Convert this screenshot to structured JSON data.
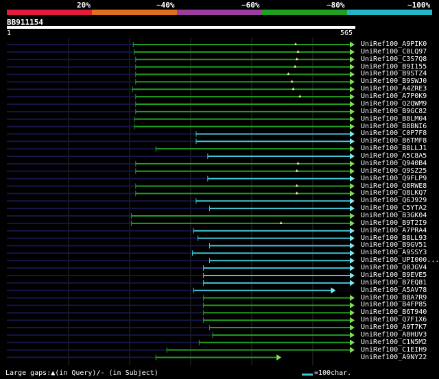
{
  "legend": {
    "labels": [
      "20%",
      "~40%",
      "~60%",
      "~80%",
      "~100%"
    ],
    "colors": [
      "#e01e3c",
      "#e07020",
      "#9a3fa0",
      "#20a020",
      "#20b8c8"
    ]
  },
  "query": {
    "id": "BB911154",
    "start": "1",
    "end": "565",
    "length": 565
  },
  "hits": [
    {
      "name": "UniRef100_A9PIK0",
      "start": 208,
      "end": 565,
      "color": "green",
      "marks": [
        474
      ]
    },
    {
      "name": "UniRef100_C0LQ97",
      "start": 210,
      "end": 565,
      "color": "green",
      "marks": [
        478
      ]
    },
    {
      "name": "UniRef100_C3S7Q8",
      "start": 212,
      "end": 565,
      "color": "green",
      "marks": [
        476
      ]
    },
    {
      "name": "UniRef100_B9I155",
      "start": 212,
      "end": 565,
      "color": "green",
      "marks": [
        473
      ]
    },
    {
      "name": "UniRef100_B9STZ4",
      "start": 212,
      "end": 565,
      "color": "green",
      "marks": [
        462
      ]
    },
    {
      "name": "UniRef100_B9SWJ0",
      "start": 212,
      "end": 565,
      "color": "green",
      "marks": [
        468
      ]
    },
    {
      "name": "UniRef100_A4ZRE3",
      "start": 207,
      "end": 565,
      "color": "green",
      "marks": [
        470
      ]
    },
    {
      "name": "UniRef100_A7P0K9",
      "start": 212,
      "end": 565,
      "color": "green",
      "marks": [
        481
      ]
    },
    {
      "name": "UniRef100_Q2QWM9",
      "start": 212,
      "end": 565,
      "color": "green",
      "marks": []
    },
    {
      "name": "UniRef100_B9GC82",
      "start": 212,
      "end": 565,
      "color": "green",
      "marks": []
    },
    {
      "name": "UniRef100_B8LM04",
      "start": 210,
      "end": 565,
      "color": "green",
      "marks": []
    },
    {
      "name": "UniRef100_B8BNI6",
      "start": 210,
      "end": 565,
      "color": "green",
      "marks": []
    },
    {
      "name": "UniRef100_C0P7F8",
      "start": 311,
      "end": 565,
      "color": "cyan",
      "marks": []
    },
    {
      "name": "UniRef100_B6TMF8",
      "start": 311,
      "end": 565,
      "color": "cyan",
      "marks": []
    },
    {
      "name": "UniRef100_B8LLJ1",
      "start": 245,
      "end": 565,
      "color": "green",
      "marks": []
    },
    {
      "name": "UniRef100_A5C8A5",
      "start": 330,
      "end": 565,
      "color": "cyan",
      "marks": []
    },
    {
      "name": "UniRef100_Q940B4",
      "start": 212,
      "end": 565,
      "color": "green",
      "marks": [
        478
      ]
    },
    {
      "name": "UniRef100_Q9SZ25",
      "start": 212,
      "end": 565,
      "color": "green",
      "marks": [
        476
      ]
    },
    {
      "name": "UniRef100_Q9FLP9",
      "start": 330,
      "end": 565,
      "color": "cyan",
      "marks": []
    },
    {
      "name": "UniRef100_Q8RWE8",
      "start": 212,
      "end": 565,
      "color": "green",
      "marks": [
        476
      ]
    },
    {
      "name": "UniRef100_Q8LKQ7",
      "start": 212,
      "end": 565,
      "color": "green",
      "marks": [
        476
      ]
    },
    {
      "name": "UniRef100_Q6J929",
      "start": 311,
      "end": 565,
      "color": "cyan",
      "marks": []
    },
    {
      "name": "UniRef100_C5YTA2",
      "start": 333,
      "end": 565,
      "color": "cyan",
      "marks": []
    },
    {
      "name": "UniRef100_B3GK04",
      "start": 205,
      "end": 565,
      "color": "green",
      "marks": []
    },
    {
      "name": "UniRef100_B9T2I9",
      "start": 205,
      "end": 565,
      "color": "green",
      "marks": [
        450
      ]
    },
    {
      "name": "UniRef100_A7PRA4",
      "start": 307,
      "end": 565,
      "color": "cyan",
      "marks": []
    },
    {
      "name": "UniRef100_B8LL93",
      "start": 314,
      "end": 565,
      "color": "cyan",
      "marks": []
    },
    {
      "name": "UniRef100_B9GV51",
      "start": 333,
      "end": 565,
      "color": "cyan",
      "marks": []
    },
    {
      "name": "UniRef100_A9SSY3",
      "start": 305,
      "end": 565,
      "color": "cyan",
      "marks": []
    },
    {
      "name": "UniRef100_UPI000...",
      "start": 333,
      "end": 565,
      "color": "cyan",
      "marks": []
    },
    {
      "name": "UniRef100_Q0JGV4",
      "start": 323,
      "end": 565,
      "color": "cyan",
      "marks": []
    },
    {
      "name": "UniRef100_B9EVE5",
      "start": 323,
      "end": 565,
      "color": "cyan",
      "marks": []
    },
    {
      "name": "UniRef100_B7EQ81",
      "start": 323,
      "end": 565,
      "color": "cyan",
      "marks": []
    },
    {
      "name": "UniRef100_A5AV78",
      "start": 307,
      "end": 534,
      "color": "cyan",
      "marks": []
    },
    {
      "name": "UniRef100_B8A7R9",
      "start": 323,
      "end": 565,
      "color": "green",
      "marks": []
    },
    {
      "name": "UniRef100_B4FP85",
      "start": 323,
      "end": 565,
      "color": "green",
      "marks": []
    },
    {
      "name": "UniRef100_B6T940",
      "start": 323,
      "end": 565,
      "color": "green",
      "marks": []
    },
    {
      "name": "UniRef100_Q7F1X6",
      "start": 323,
      "end": 565,
      "color": "green",
      "marks": []
    },
    {
      "name": "UniRef100_A9T7K7",
      "start": 333,
      "end": 565,
      "color": "green",
      "marks": []
    },
    {
      "name": "UniRef100_A8HUV3",
      "start": 338,
      "end": 565,
      "color": "green",
      "marks": []
    },
    {
      "name": "UniRef100_C1N5M2",
      "start": 316,
      "end": 565,
      "color": "green",
      "marks": []
    },
    {
      "name": "UniRef100_C1EIH9",
      "start": 263,
      "end": 565,
      "color": "green",
      "marks": []
    },
    {
      "name": "UniRef100_A9NY22",
      "start": 245,
      "end": 445,
      "color": "green",
      "marks": []
    }
  ],
  "hit_colors": {
    "green": "#20a020",
    "cyan": "#40c8d8",
    "triangle_green": "#7ee050",
    "triangle_cyan": "#7ee8f0",
    "dark": "#15154a"
  },
  "footer": {
    "text": "Large gaps:▲(in Query)/- (in Subject)",
    "key": "=100char."
  }
}
